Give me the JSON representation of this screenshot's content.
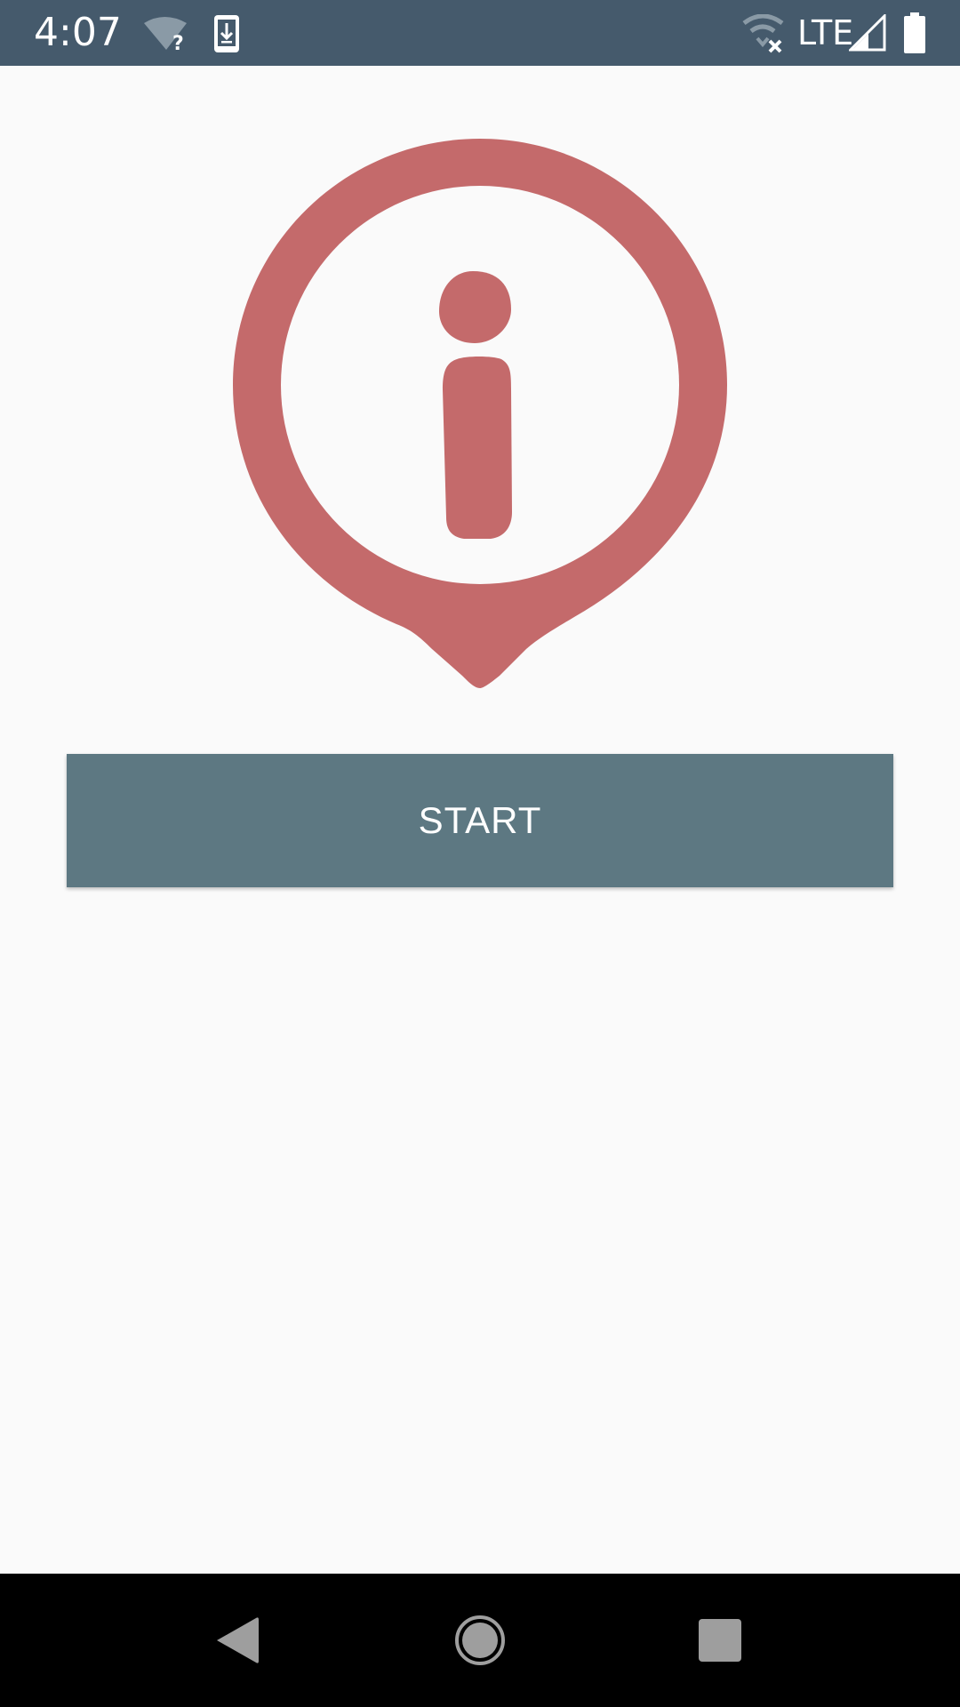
{
  "status_bar": {
    "time": "4:07",
    "network_label": "LTE",
    "background_color": "#455a6c",
    "icons": [
      "wifi-unknown-icon",
      "download-icon",
      "wifi-off-icon",
      "signal-icon",
      "battery-icon"
    ]
  },
  "main": {
    "logo_icon": "info-pin-icon",
    "logo_color": "#c46a6b",
    "start_button_label": "START",
    "start_button_color": "#5d7882"
  },
  "nav_bar": {
    "icons": [
      "back-icon",
      "home-icon",
      "recents-icon"
    ]
  }
}
